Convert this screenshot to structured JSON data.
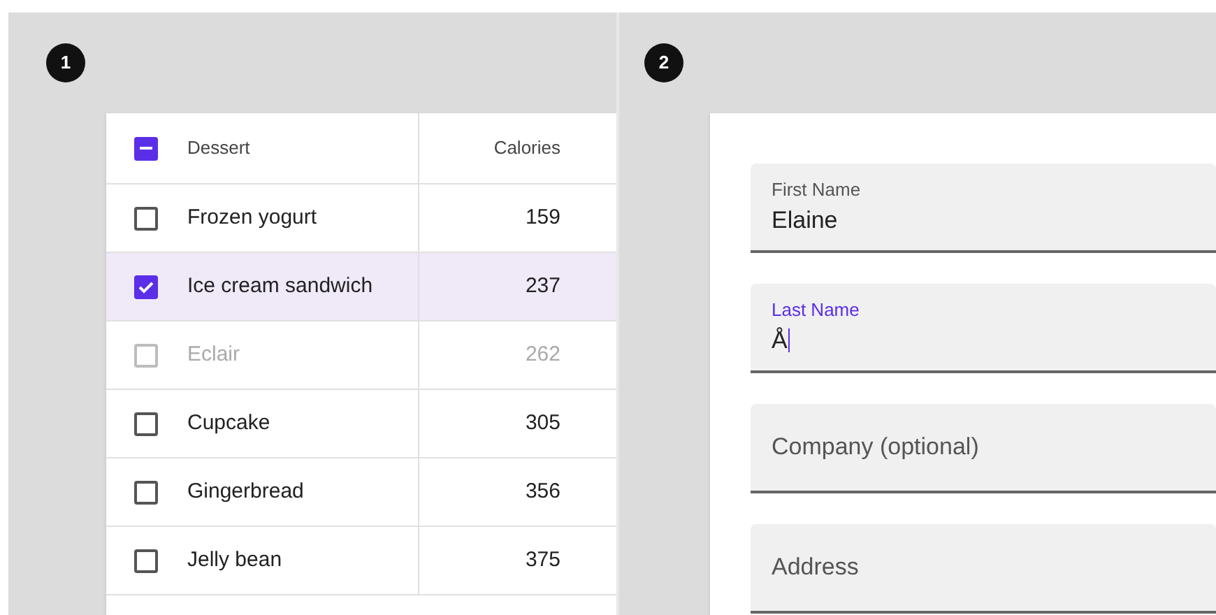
{
  "panels": [
    {
      "badge": "1"
    },
    {
      "badge": "2"
    }
  ],
  "table": {
    "header_checkbox": {
      "indeterminate": true
    },
    "columns": [
      "Dessert",
      "Calories"
    ],
    "rows": [
      {
        "dessert": "Frozen yogurt",
        "calories": "159",
        "selected": false,
        "disabled": false
      },
      {
        "dessert": "Ice cream sandwich",
        "calories": "237",
        "selected": true,
        "disabled": false
      },
      {
        "dessert": "Eclair",
        "calories": "262",
        "selected": false,
        "disabled": true
      },
      {
        "dessert": "Cupcake",
        "calories": "305",
        "selected": false,
        "disabled": false
      },
      {
        "dessert": "Gingerbread",
        "calories": "356",
        "selected": false,
        "disabled": false
      },
      {
        "dessert": "Jelly bean",
        "calories": "375",
        "selected": false,
        "disabled": false
      }
    ]
  },
  "form": {
    "fields": [
      {
        "label": "First Name",
        "value": "Elaine",
        "focused": false
      },
      {
        "label": "Last Name",
        "value": "Å",
        "focused": true
      },
      {
        "label": "Company (optional)",
        "focused": false
      },
      {
        "label": "Address",
        "focused": false
      }
    ]
  }
}
